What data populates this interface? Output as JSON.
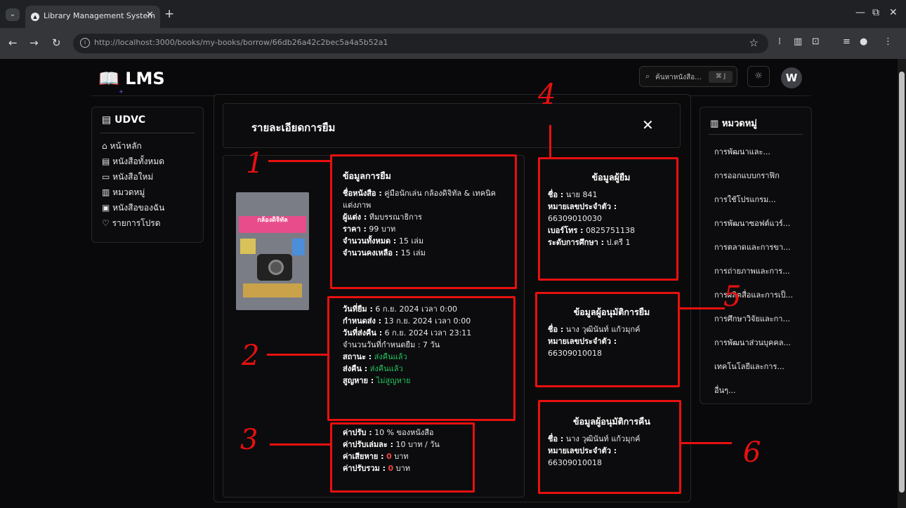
{
  "browser": {
    "tab_title": "Library Management System",
    "url": "http://localhost:3000/books/my-books/borrow/66db26a42c2bec5a4a5b52a1"
  },
  "header": {
    "logo": "LMS",
    "search_placeholder": "ค้นหาหนังสือ...",
    "search_kbd": "⌘ J",
    "avatar": "W"
  },
  "sidebar": {
    "title": "UDVC",
    "items": [
      "หน้าหลัก",
      "หนังสือทั้งหมด",
      "หนังสือใหม่",
      "หมวดหมู่",
      "หนังสือของฉัน",
      "รายการโปรด"
    ]
  },
  "categories": {
    "title": "หมวดหมู่",
    "items": [
      "การพัฒนาและ...",
      "การออกแบบกราฟิก",
      "การใช้โปรแกรม...",
      "การพัฒนาซอฟต์แวร์...",
      "การตลาดและการขา...",
      "การถ่ายภาพและการ...",
      "การผลิตสื่อและการเป็...",
      "การศึกษาวิจัยและกา...",
      "การพัฒนาส่วนบุคคล...",
      "เทคโนโลยีและการ...",
      "อื่นๆ..."
    ]
  },
  "modal": {
    "title": "รายละเอียดการยืม",
    "close": "✕",
    "borrow_info": {
      "heading": "ข้อมูลการยืม",
      "name_label": "ชื่อหนังสือ :",
      "name_value": "คู่มือนักเล่น กล้องดิจิทัล & เทคนิคแต่งภาพ",
      "author_label": "ผู้แต่ง :",
      "author_value": "ทีมบรรณาธิการ",
      "price_label": "ราคา :",
      "price_value": "99 บาท",
      "total_label": "จำนวนทั้งหมด :",
      "total_value": "15 เล่ม",
      "remain_label": "จำนวนคงเหลือ :",
      "remain_value": "15 เล่ม"
    },
    "dates": {
      "borrow_label": "วันที่ยืม :",
      "borrow_value": "6 ก.ย. 2024 เวลา 0:00",
      "due_label": "กำหนดส่ง :",
      "due_value": "13 ก.ย. 2024 เวลา 0:00",
      "return_label": "วันที่ส่งคืน :",
      "return_value": "6 ก.ย. 2024 เวลา 23:11",
      "days_text": "จำนวนวันที่กำหนดยืม : 7 วัน",
      "status_label": "สถานะ :",
      "status_value": "ส่งคืนแล้ว",
      "returned_label": "ส่งคืน :",
      "returned_value": "ส่งคืนแล้ว",
      "lost_label": "สูญหาย :",
      "lost_value": "ไม่สูญหาย"
    },
    "fines": {
      "fine_label": "ค่าปรับ :",
      "fine_value": "10 % ของหนังสือ",
      "perbook_label": "ค่าปรับเล่มละ :",
      "perbook_value": "10 บาท / วัน",
      "damage_label": "ค่าเสียหาย :",
      "damage_value": "0",
      "total_label": "ค่าปรับรวม :",
      "total_value": "0",
      "baht": "บาท"
    },
    "borrower": {
      "heading": "ข้อมูลผู้ยืม",
      "name_label": "ชื่อ :",
      "name_value": "นาย 841",
      "id_label": "หมายเลขประจำตัว :",
      "id_value": "66309010030",
      "phone_label": "เบอร์โทร :",
      "phone_value": "0825751138",
      "edu_label": "ระดับการศึกษา :",
      "edu_value": "ป.ตรี 1"
    },
    "approver_borrow": {
      "heading": "ข้อมูลผู้อนุมัติการยืม",
      "name_label": "ชื่อ :",
      "name_value": "นาง วุฒินันท์ แก้วมุกค์",
      "id_label": "หมายเลขประจำตัว :",
      "id_value": "66309010018"
    },
    "approver_return": {
      "heading": "ข้อมูลผู้อนุมัติการคืน",
      "name_label": "ชื่อ :",
      "name_value": "นาง วุฒินันท์ แก้วมุกค์",
      "id_label": "หมายเลขประจำตัว :",
      "id_value": "66309010018"
    }
  },
  "annotations": [
    "1",
    "2",
    "3",
    "4",
    "5",
    "6"
  ],
  "colors": {
    "accent_red": "#e8100f",
    "status_green": "#22c55e",
    "zero_red": "#ef4444"
  }
}
